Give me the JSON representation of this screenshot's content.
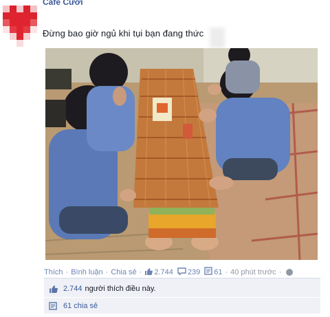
{
  "page": {
    "name": "Cafe Cười",
    "caption": "Đừng bao giờ ngủ khi tụi bạn đang thức"
  },
  "actions": {
    "like": "Thích",
    "comment": "Bình luận",
    "share": "Chia sẻ",
    "like_count": "2.744",
    "comment_count": "239",
    "share_count": "61",
    "time": "40 phút trước",
    "separator": "·"
  },
  "ufi": {
    "likes_count": "2.744",
    "likes_text": "người thích điều này.",
    "shares_text": "61 chia sẻ"
  },
  "colors": {
    "link": "#6d84b4",
    "meta": "#9197a3",
    "ufi_bg": "#eff1f6",
    "heart": "#e0242f"
  }
}
